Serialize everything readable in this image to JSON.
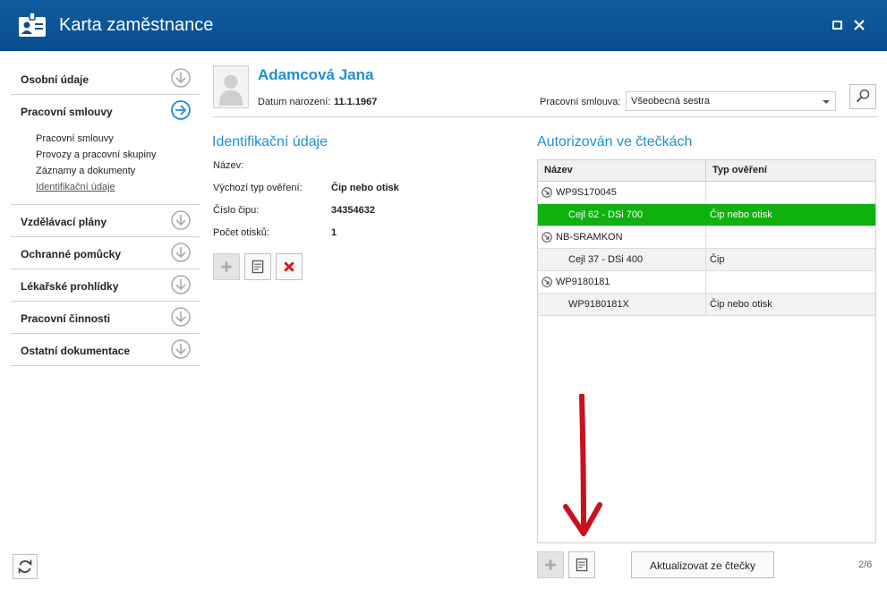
{
  "window": {
    "title": "Karta zaměstnance"
  },
  "sidebar": {
    "items": [
      {
        "label": "Osobní údaje"
      },
      {
        "label": "Pracovní smlouvy"
      },
      {
        "label": "Vzdělávací plány"
      },
      {
        "label": "Ochranné pomůcky"
      },
      {
        "label": "Lékařské prohlídky"
      },
      {
        "label": "Pracovní činnosti"
      },
      {
        "label": "Ostatní dokumentace"
      }
    ],
    "subitems": [
      {
        "label": "Pracovní smlouvy"
      },
      {
        "label": "Provozy a pracovní skupiny"
      },
      {
        "label": "Záznamy a dokumenty"
      },
      {
        "label": "Identifikační údaje"
      }
    ]
  },
  "employee": {
    "name": "Adamcová Jana",
    "dob_label": "Datum narození:",
    "dob_value": "11.1.1967",
    "contract_label": "Pracovní smlouva:",
    "contract_value": "Všeobecná sestra"
  },
  "identification": {
    "title": "Identifikační údaje",
    "fields": [
      {
        "label": "Název:",
        "value": ""
      },
      {
        "label": "Výchozí typ ověření:",
        "value": "Čip nebo otisk"
      },
      {
        "label": "Číslo čipu:",
        "value": "34354632"
      },
      {
        "label": "Počet otisků:",
        "value": "1"
      }
    ]
  },
  "authorized": {
    "title": "Autorizován ve čtečkách",
    "columns": [
      "Název",
      "Typ ověření"
    ],
    "rows": [
      {
        "name": "WP9S170045",
        "type": ""
      },
      {
        "name": "Cejl 62 - DSi 700",
        "type": "Čip nebo otisk"
      },
      {
        "name": "NB-SRAMKON",
        "type": ""
      },
      {
        "name": "Cejl 37 - DSi 400",
        "type": "Čip"
      },
      {
        "name": "WP9180181",
        "type": ""
      },
      {
        "name": "WP9180181X",
        "type": "Čip nebo otisk"
      }
    ],
    "update_button": "Aktualizovat ze čtečky",
    "pager": "2/6"
  },
  "colors": {
    "titlebar": "#0a4f8d",
    "accent": "#1f8fd6",
    "selected_row": "#0fb10f",
    "annotation_arrow": "#c8101e"
  },
  "icons": {
    "app": "id-card-icon",
    "maximize": "maximize-icon",
    "close": "close-icon",
    "nav": "arrow-circle-icon",
    "search": "magnifier-icon",
    "add": "plus-icon",
    "edit": "edit-document-icon",
    "delete": "delete-x-icon",
    "refresh": "refresh-icon",
    "group": "group-expand-icon"
  }
}
